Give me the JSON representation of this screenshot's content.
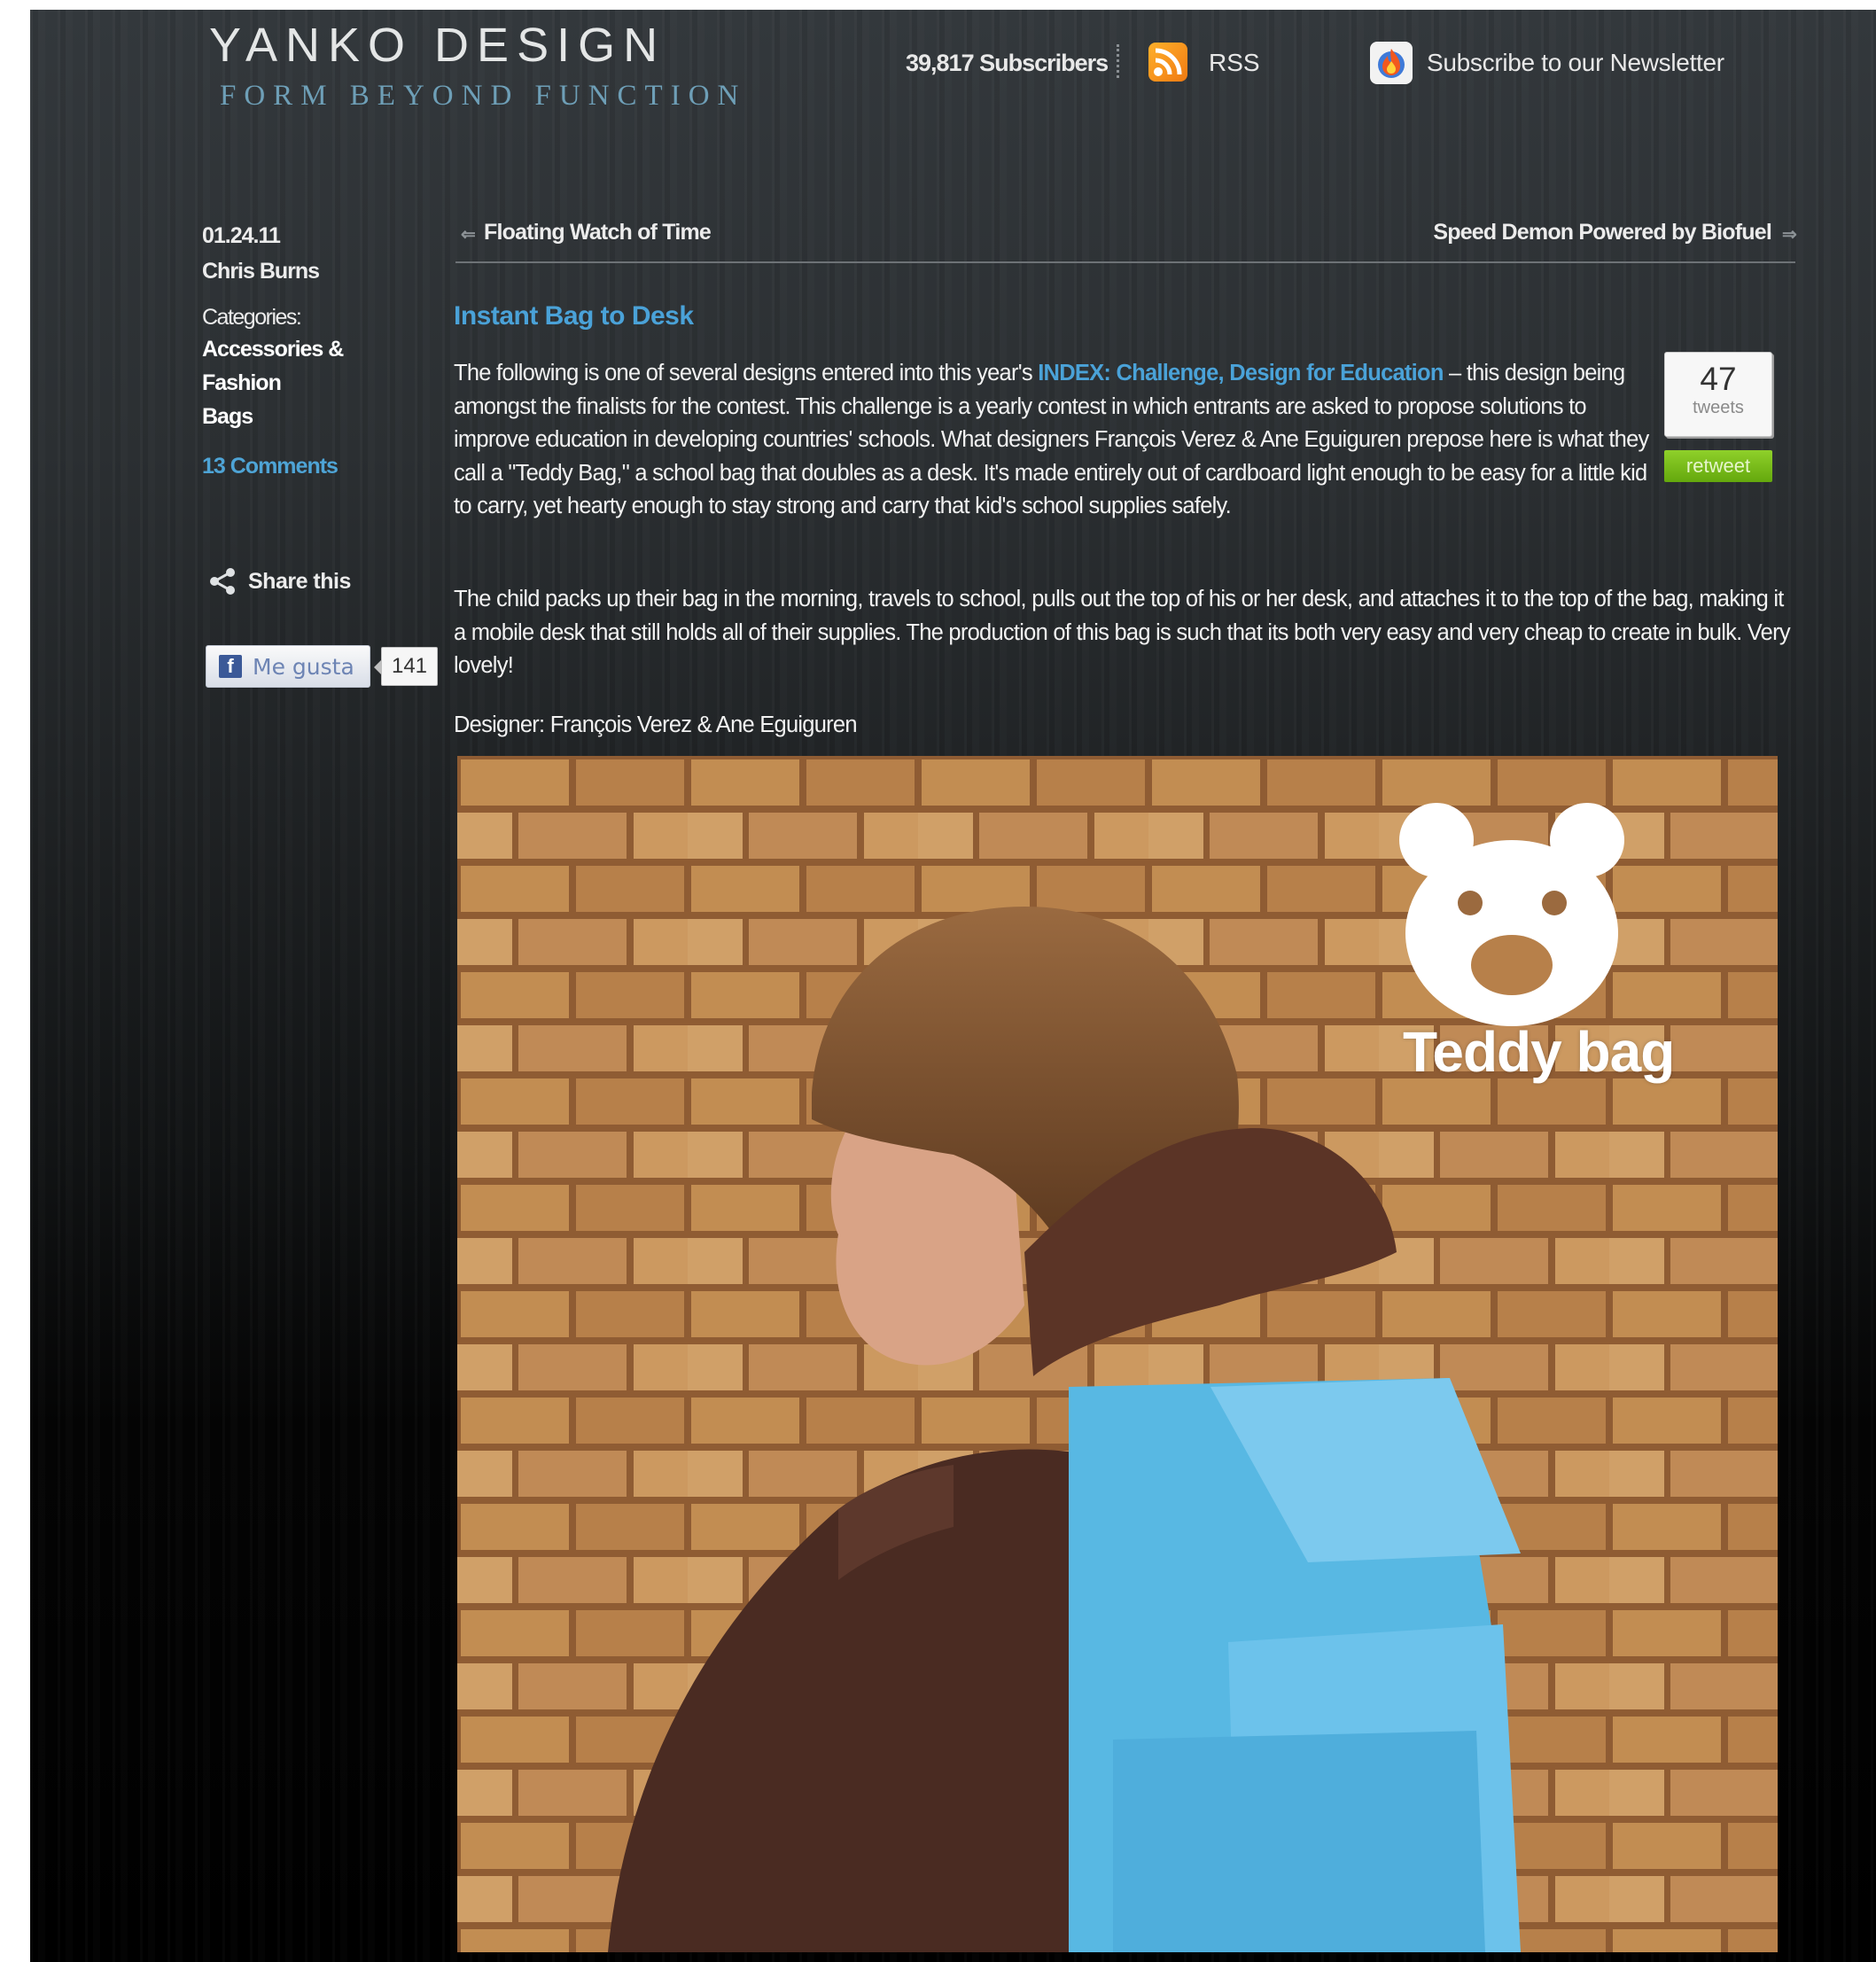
{
  "header": {
    "logo_title": "YANKO DESIGN",
    "logo_tagline": "FORM BEYOND FUNCTION",
    "subscribers": "39,817 Subscribers",
    "rss_label": "RSS",
    "newsletter_label": "Subscribe to our Newsletter"
  },
  "sidebar": {
    "date": "01.24.11",
    "author": "Chris Burns",
    "categories_label": "Categories:",
    "categories": [
      "Accessories &",
      "Fashion",
      "Bags"
    ],
    "comments": "13 Comments",
    "share_label": "Share this",
    "like_label": "Me gusta",
    "like_count": "141"
  },
  "post_nav": {
    "prev": "Floating Watch of Time",
    "next": "Speed Demon Powered by Biofuel"
  },
  "post": {
    "title": "Instant Bag to Desk",
    "intro_before_link": "The following is one of several designs entered into this year's ",
    "intro_link": "INDEX: Challenge, Design for Education",
    "intro_after_link": " – this design being amongst the finalists for the contest. This challenge is a yearly contest in which entrants are asked to propose solutions to improve education in developing countries' schools. What designers François Verez & Ane Eguiguren prepose here is what they call a \"Teddy Bag,\" a school bag that doubles as a desk. It's made entirely out of cardboard light enough to be easy for a little kid to carry, yet hearty enough to stay strong and carry that kid's school supplies safely.",
    "paragraph2": "The child packs up their bag in the morning, travels to school, pulls out the top of his or her desk, and attaches it to the top of the bag, making it a mobile desk that still holds all of their supplies. The production of this bag is such that its both very easy and very cheap to create in bulk. Very lovely!",
    "designer": "Designer: François Verez & Ane Eguiguren",
    "photo_label": "Teddy bag"
  },
  "tweet_widget": {
    "count": "47",
    "count_label": "tweets",
    "button_label": "retweet"
  },
  "colors": {
    "link_blue": "#4aa2d8",
    "retweet_green": "#74b816",
    "rss_orange": "#f28a1a",
    "tagline_blue": "#6e9fb7"
  },
  "icons": [
    "rss-icon",
    "newsletter-icon",
    "share-icon",
    "facebook-icon",
    "left-arrow-icon",
    "right-arrow-icon"
  ]
}
